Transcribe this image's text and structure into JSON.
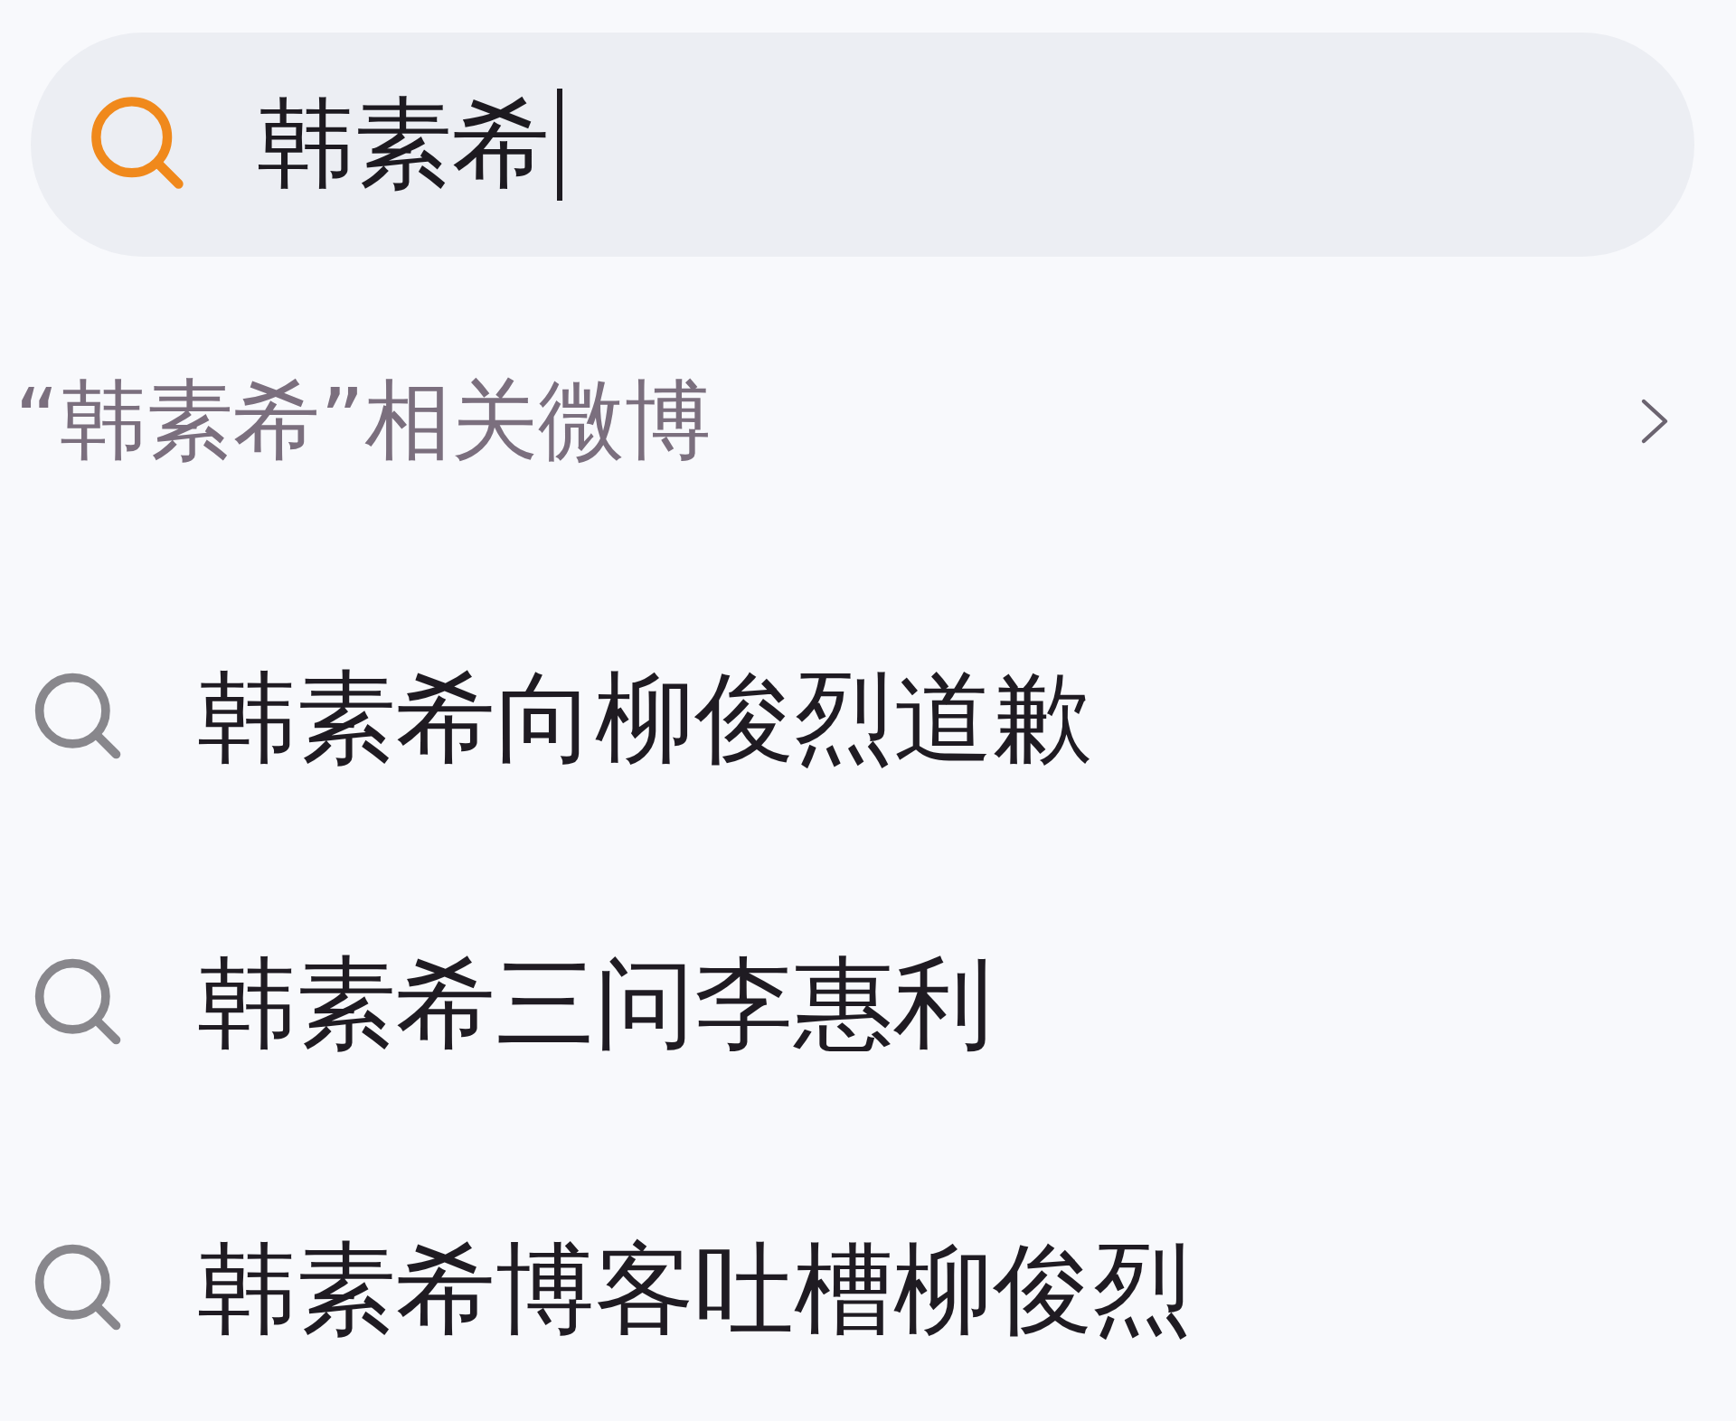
{
  "search": {
    "value": "韩素希",
    "focused": true
  },
  "related": {
    "label": "“韩素希”相关微博"
  },
  "suggestions": [
    {
      "text": "韩素希向柳俊烈道歉"
    },
    {
      "text": "韩素希三问李惠利"
    },
    {
      "text": "韩素希博客吐槽柳俊烈"
    }
  ]
}
